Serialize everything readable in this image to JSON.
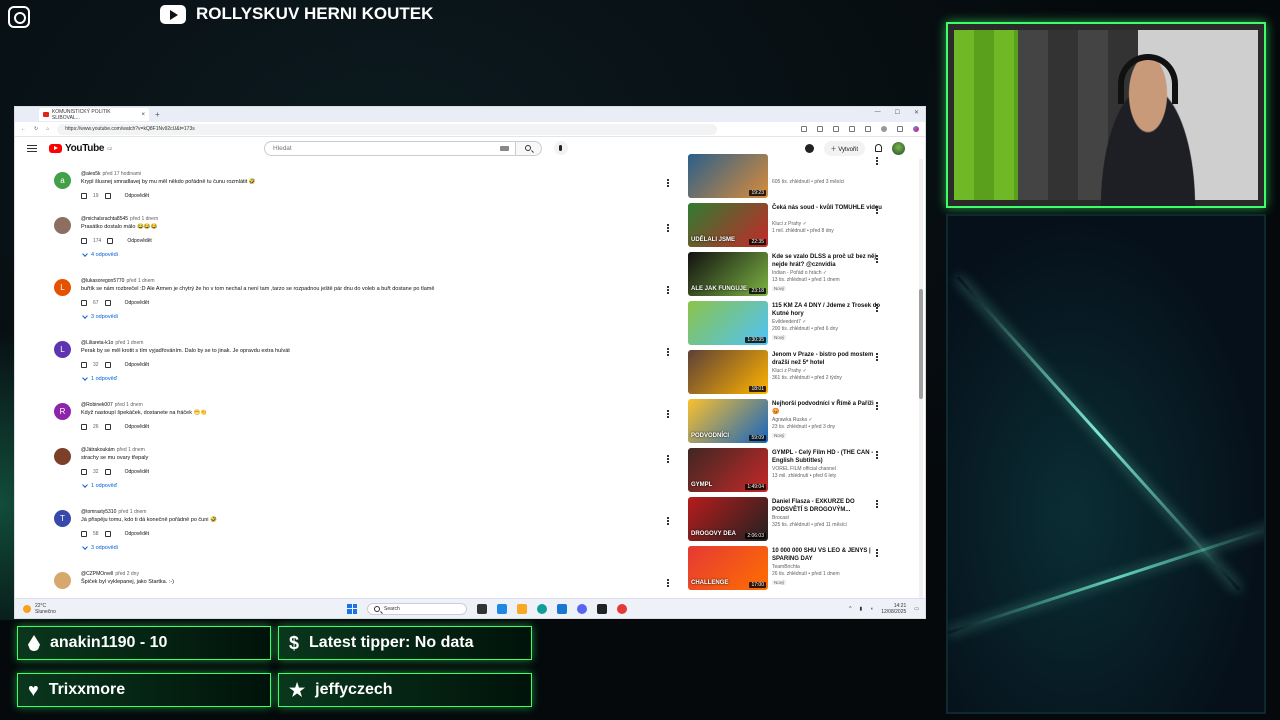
{
  "stream": {
    "channel_title": "ROLLYSKUV HERNI KOUTEK",
    "widgets": [
      {
        "icon": "drop-icon",
        "text": "anakin1190 - 10"
      },
      {
        "icon": "dollar-icon",
        "text": "Latest tipper: No data"
      },
      {
        "icon": "heart-icon",
        "text": "Trixxmore"
      },
      {
        "icon": "star-icon",
        "text": "jeffyczech"
      }
    ]
  },
  "browser": {
    "tab_title": "KOMUNISTICKÝ POLITIK SLIBOVAL...",
    "url": "https://www.youtube.com/watch?v=kQ8F1Nv92cU&t=173s"
  },
  "youtube": {
    "logo_text": "YouTube",
    "logo_sup": "CZ",
    "search_placeholder": "Hledat",
    "create_label": "Vytvořit"
  },
  "comments": [
    {
      "avatar_letter": "a",
      "avatar_color": "#43a047",
      "user": "@ales5k",
      "time": "před 17 hodinami",
      "text": "Krypl šlusnej smradlavej by mu měl někdo pořádně tu čunu rozmlátit 🤣",
      "likes": "19",
      "reply_label": "Odpovědět",
      "replies": ""
    },
    {
      "avatar_letter": "",
      "avatar_color": "#8d6e63",
      "user": "@michalsrachta8545",
      "time": "před 1 dnem",
      "text": "Prasátko dostalo málo 😂😂😂",
      "likes": "174",
      "reply_label": "Odpovědět",
      "replies": "4 odpovědi"
    },
    {
      "avatar_letter": "L",
      "avatar_color": "#e65100",
      "user": "@lukasoregon5770",
      "time": "před 1 dnem",
      "text": "buřtík se nám rozbrečel :D Ale Armen je chytrý že ho v tom nechal a není tam ,tarzo se rozpadnou ještě pár dnu do voleb a buřt dostane po tlamě",
      "likes": "67",
      "reply_label": "Odpovědět",
      "replies": "3 odpovědi"
    },
    {
      "avatar_letter": "L",
      "avatar_color": "#5e35b1",
      "user": "@Liliareta-k1o",
      "time": "před 1 dnem",
      "text": "Perak by se měl krotit s tím vyjadřováním. Dalo by se to jinak. Je opravdu extra hulvát",
      "likes": "32",
      "reply_label": "Odpovědět",
      "replies": "1 odpověď"
    },
    {
      "avatar_letter": "R",
      "avatar_color": "#8e24aa",
      "user": "@Robinek007",
      "time": "před 1 dnem",
      "text": "Když nastoupí špekáček, dostanete na fráček 😁👏",
      "likes": "26",
      "reply_label": "Odpovědět",
      "replies": ""
    },
    {
      "avatar_letter": "",
      "avatar_color": "#7b3f2a",
      "user": "@Játrakoukám",
      "time": "před 1 dnem",
      "text": "strachy se mu ovary třepaly",
      "likes": "32",
      "reply_label": "Odpovědět",
      "replies": "1 odpověď"
    },
    {
      "avatar_letter": "T",
      "avatar_color": "#3949ab",
      "user": "@tomrasty5310",
      "time": "před 1 dnem",
      "text": "Já přispěju tomu, kdo ti dá konečně pořádně po čuni 🤣",
      "likes": "58",
      "reply_label": "Odpovědět",
      "replies": "3 odpovědi"
    },
    {
      "avatar_letter": "",
      "avatar_color": "#d7a86e",
      "user": "@CZPMOrvell",
      "time": "před 2 dny",
      "text": "Špiček byl vyklepanej, jako Startka. :-)",
      "likes": "",
      "reply_label": "",
      "replies": ""
    }
  ],
  "videos": [
    {
      "title": "",
      "channel": "",
      "meta": "605 tis. zhlédnutí • před 3 měsíci",
      "badge": "",
      "duration": "19:23",
      "thumb_text": "",
      "colors": [
        "#2b5f8a",
        "#d98c3a"
      ]
    },
    {
      "title": "Čeká nás soud - kvůli TOMUHLE videu",
      "channel": "Kluci z Prahy ✓",
      "meta": "1 mil. zhlédnutí • před 8 dny",
      "badge": "",
      "duration": "22:35",
      "thumb_text": "UDĚLALI JSME",
      "colors": [
        "#2e7d32",
        "#c62828"
      ]
    },
    {
      "title": "Kde se vzalo DLSS a proč už bez něj nejde hrát? @cznvidia",
      "channel": "Indian - Pořád o hrách ✓",
      "meta": "13 tis. zhlédnutí • před 1 dnem",
      "badge": "Nový",
      "duration": "23:18",
      "thumb_text": "ALE JAK FUNGUJE",
      "colors": [
        "#111111",
        "#7cb342"
      ]
    },
    {
      "title": "115 KM ZA 4 DNY / Jdeme z Trosek do Kutné hory",
      "channel": "Evildeedent7 ✓",
      "meta": "200 tis. zhlédnutí • před 6 dny",
      "badge": "Nový",
      "duration": "1:30:35",
      "thumb_text": "",
      "colors": [
        "#8bc34a",
        "#4fc3f7"
      ]
    },
    {
      "title": "Jenom v Praze - bistro pod mostem dražší než 5* hotel",
      "channel": "Kluci z Prahy ✓",
      "meta": "361 tis. zhlédnutí • před 2 týdny",
      "badge": "",
      "duration": "18:01",
      "thumb_text": "",
      "colors": [
        "#5d4037",
        "#ffb300"
      ]
    },
    {
      "title": "Nejhorší podvodníci v Římě a Paříži 😡",
      "channel": "Agrawka Ruska ✓",
      "meta": "23 tis. zhlédnutí • před 3 dny",
      "badge": "Nový",
      "duration": "59:09",
      "thumb_text": "PODVODNÍCI",
      "colors": [
        "#fbc02d",
        "#1565c0"
      ]
    },
    {
      "title": "GYMPL - Celý Film HD - (THE CAN - English Subtitles)",
      "channel": "VOREL FILM official channel",
      "meta": "13 mil. zhlédnutí • před 6 lety",
      "badge": "",
      "duration": "1:49:04",
      "thumb_text": "GYMPL",
      "colors": [
        "#3e2723",
        "#c62828"
      ]
    },
    {
      "title": "Daniel Flasza - EXKURZE DO PODSVĚTÍ S DROGOVÝM...",
      "channel": "Brocast",
      "meta": "325 tis. zhlédnutí • před 11 měsíci",
      "badge": "",
      "duration": "2:06:03",
      "thumb_text": "DROGOVY DEA",
      "colors": [
        "#b71c1c",
        "#212121"
      ]
    },
    {
      "title": "10 000 000 SHU VS LEO & JENYS | SPARING DAY",
      "channel": "TeamBrichta",
      "meta": "26 tis. zhlédnutí • před 1 dnem",
      "badge": "Nový",
      "duration": "17:00",
      "thumb_text": "CHALLENGE",
      "colors": [
        "#e53935",
        "#ff6f00"
      ]
    }
  ],
  "taskbar": {
    "weather_temp": "22°C",
    "weather_desc": "Slunečno",
    "search_placeholder": "Search",
    "time": "14:21",
    "date": "12/08/2025"
  }
}
